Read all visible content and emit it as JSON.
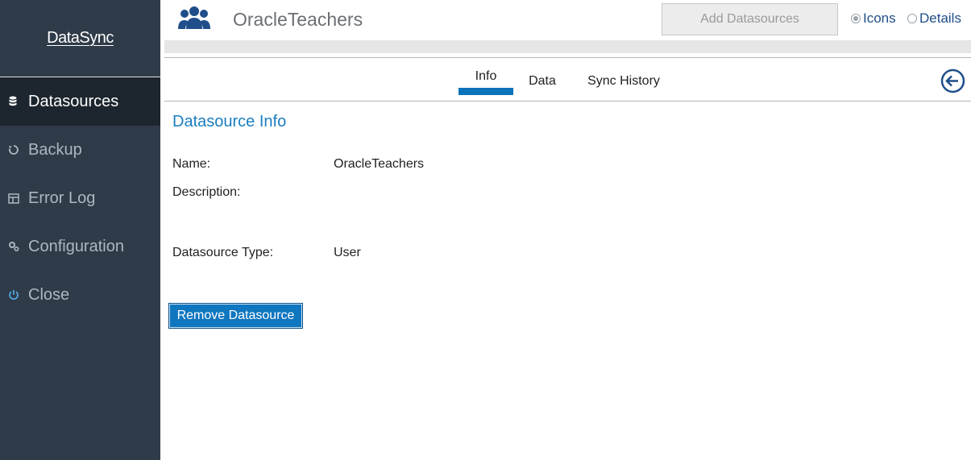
{
  "app": {
    "logo_text": "DataSync"
  },
  "sidebar": {
    "items": [
      {
        "label": "Datasources",
        "icon": "database-icon",
        "active": true
      },
      {
        "label": "Backup",
        "icon": "refresh-icon",
        "active": false
      },
      {
        "label": "Error Log",
        "icon": "table-icon",
        "active": false
      },
      {
        "label": "Configuration",
        "icon": "gears-icon",
        "active": false
      },
      {
        "label": "Close",
        "icon": "power-icon",
        "active": false
      }
    ]
  },
  "header": {
    "icon": "users-icon",
    "title": "OracleTeachers",
    "add_button_label": "Add Datasources",
    "view_options": [
      {
        "label": "Icons",
        "checked": true
      },
      {
        "label": "Details",
        "checked": false
      }
    ]
  },
  "tabs": [
    {
      "label": "Info",
      "active": true
    },
    {
      "label": "Data",
      "active": false
    },
    {
      "label": "Sync History",
      "active": false
    }
  ],
  "back_icon": "arrow-left-circle-icon",
  "info": {
    "section_title": "Datasource Info",
    "fields": [
      {
        "label": "Name:",
        "value": "OracleTeachers"
      },
      {
        "label": "Description:",
        "value": ""
      },
      {
        "label": "Datasource Type:",
        "value": "User"
      }
    ],
    "remove_button_label": "Remove Datasource"
  },
  "colors": {
    "sidebar_bg": "#2f3b48",
    "sidebar_active_bg": "#1d252e",
    "accent_blue": "#1a7ec0",
    "tab_underline": "#0a73b9",
    "button_blue": "#0f76c0"
  }
}
